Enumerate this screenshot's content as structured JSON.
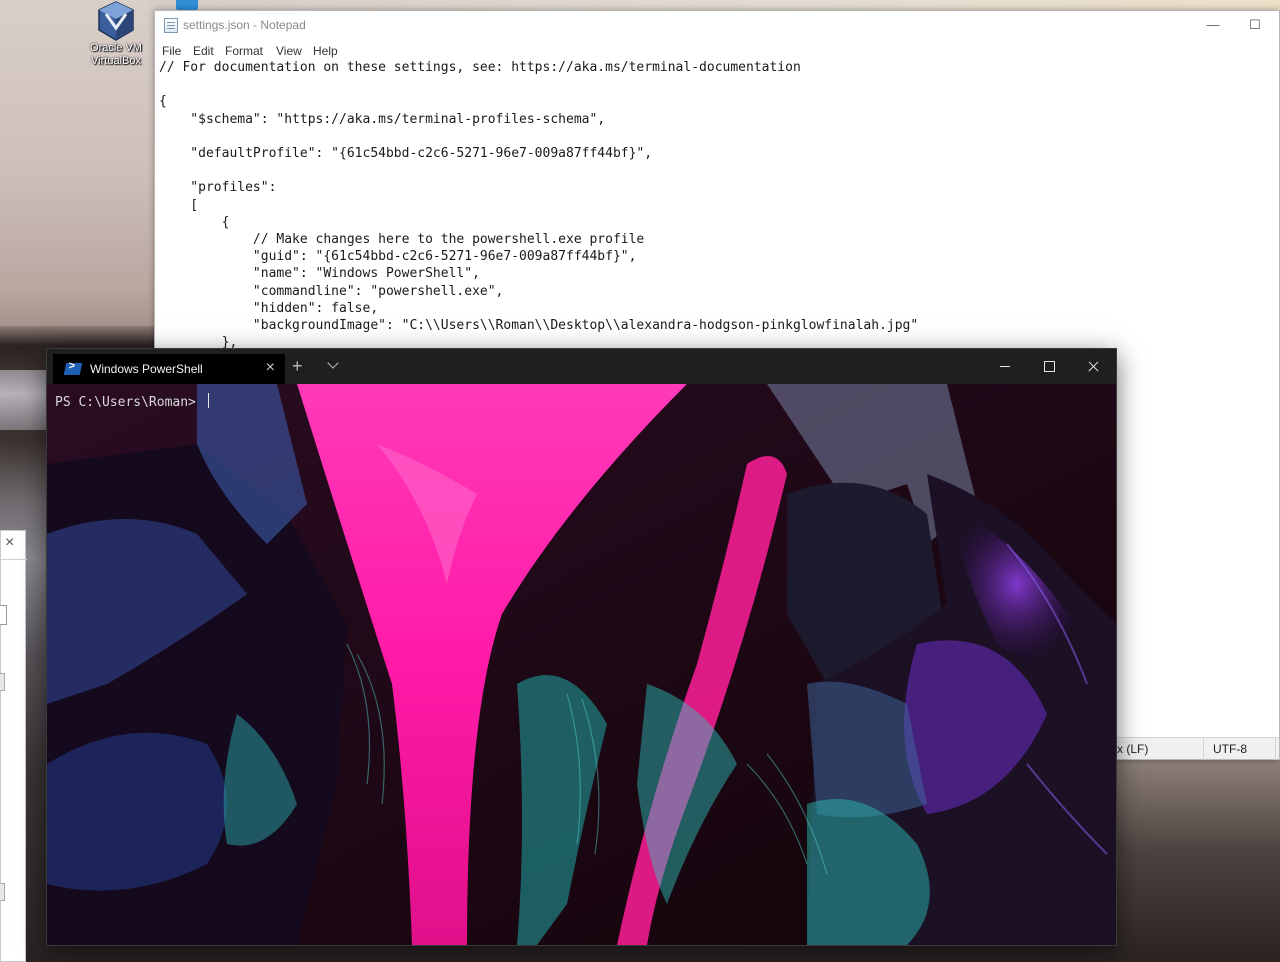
{
  "desktop": {
    "icons": [
      {
        "name": "virtualbox",
        "label_line1": "Oracle VM",
        "label_line2": "VirtualBox"
      }
    ]
  },
  "notepad": {
    "title": "settings.json - Notepad",
    "menu": [
      "File",
      "Edit",
      "Format",
      "View",
      "Help"
    ],
    "lines": [
      "// For documentation on these settings, see: https://aka.ms/terminal-documentation",
      "",
      "{",
      "    \"$schema\": \"https://aka.ms/terminal-profiles-schema\",",
      "",
      "    \"defaultProfile\": \"{61c54bbd-c2c6-5271-96e7-009a87ff44bf}\",",
      "",
      "    \"profiles\":",
      "    [",
      "        {",
      "            // Make changes here to the powershell.exe profile",
      "            \"guid\": \"{61c54bbd-c2c6-5271-96e7-009a87ff44bf}\",",
      "            \"name\": \"Windows PowerShell\",",
      "            \"commandline\": \"powershell.exe\",",
      "            \"hidden\": false,",
      "            \"backgroundImage\": \"C:\\\\Users\\\\Roman\\\\Desktop\\\\alexandra-hodgson-pinkglowfinalah.jpg\"",
      "        },"
    ],
    "status": {
      "line_ending": "x (LF)",
      "encoding": "UTF-8"
    }
  },
  "terminal": {
    "tab_title": "Windows PowerShell",
    "prompt": "PS C:\\Users\\Roman> "
  },
  "colors": {
    "pink": "#ff1aa8",
    "cyan": "#2fc7c4",
    "violet": "#7a2fd6",
    "terminal_bg": "#1a0712"
  }
}
